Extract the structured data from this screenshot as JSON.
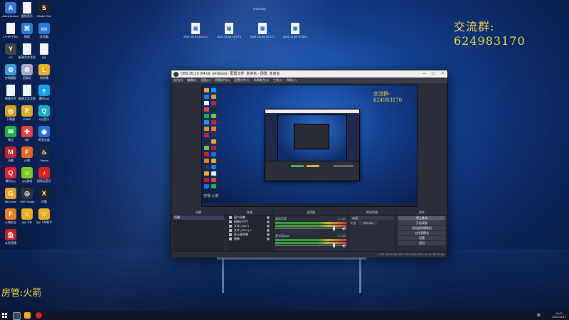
{
  "desktop": {
    "watermark_qq": "交流群: 624983170",
    "watermark_admin": "房管:火箭",
    "icons": [
      {
        "label": "Administrator",
        "color": "#3a78d8",
        "glyph": "A"
      },
      {
        "label": "酷狗音乐",
        "color": "#f4f6fa",
        "glyph": ""
      },
      {
        "label": "Studio One",
        "color": "#222",
        "glyph": "S"
      },
      {
        "label": "4THRTFMC",
        "color": "#f4f6fa",
        "glyph": ""
      },
      {
        "label": "网络",
        "color": "#2a7bd8",
        "glyph": "⌘"
      },
      {
        "label": "此电脑",
        "color": "#2a7bd8",
        "glyph": "▭"
      },
      {
        "label": "YY",
        "color": "#444",
        "glyph": "Y"
      },
      {
        "label": "新建文本文档",
        "color": "#f4f6fa",
        "glyph": ""
      },
      {
        "label": "QQ",
        "color": "#f4f6fa",
        "glyph": ""
      },
      {
        "label": "控制面板",
        "color": "#3a9ad8",
        "glyph": "⚙"
      },
      {
        "label": "回收站",
        "color": "#aac",
        "glyph": "♻"
      },
      {
        "label": "快剪辑",
        "color": "#e8b020",
        "glyph": "L"
      },
      {
        "label": "新建文件",
        "color": "#f4f6fa",
        "glyph": ""
      },
      {
        "label": "新建文本文档",
        "color": "#f4f6fa",
        "glyph": ""
      },
      {
        "label": "腾讯QQ",
        "color": "#12a0e8",
        "glyph": "e"
      },
      {
        "label": "下载器",
        "color": "#d8a020",
        "glyph": "◎"
      },
      {
        "label": "PUBG",
        "color": "#d8b020",
        "glyph": "P"
      },
      {
        "label": "QQ音乐",
        "color": "#12b0c0",
        "glyph": "Q"
      },
      {
        "label": "微信",
        "color": "#25b04a",
        "glyph": "✉"
      },
      {
        "label": "360",
        "color": "#e84040",
        "glyph": "✚"
      },
      {
        "label": "阿里云盘",
        "color": "#2a6fd8",
        "glyph": "◉"
      },
      {
        "label": "迅雷",
        "color": "#c82030",
        "glyph": "M"
      },
      {
        "label": "火绒",
        "color": "#e86820",
        "glyph": "F"
      },
      {
        "label": "Steam",
        "color": "#1b2838",
        "glyph": "♨"
      },
      {
        "label": "腾讯QQ",
        "color": "#e82040",
        "glyph": "Q"
      },
      {
        "label": "QQ游戏",
        "color": "#80c820",
        "glyph": "☺"
      },
      {
        "label": "网易云音乐",
        "color": "#d82020",
        "glyph": "♪"
      },
      {
        "label": "WeGame",
        "color": "#e8a020",
        "glyph": "G"
      },
      {
        "label": "OBS Studio",
        "color": "#333",
        "glyph": "◎"
      },
      {
        "label": "优酷",
        "color": "#222",
        "glyph": "X"
      },
      {
        "label": "火绒安全",
        "color": "#e88020",
        "glyph": "F"
      },
      {
        "label": "QQ飞车",
        "color": "#e8b020",
        "glyph": "☺"
      },
      {
        "label": "QQ飞车助手",
        "color": "#e8b020",
        "glyph": "☺"
      },
      {
        "label": "斗鱼直播",
        "color": "#c82020",
        "glyph": "鱼"
      }
    ],
    "top_files": [
      {
        "label": "2021-09-03 18:15:48..."
      },
      {
        "label": "2021-11-08 21:27:44..."
      },
      {
        "label": "2021-09-16 22:27:48..."
      },
      {
        "label": "2021-11-03 10:51:41..."
      }
    ],
    "top_file_extra": "NTRHMC"
  },
  "obs": {
    "title": "OBS 26.1.0 (64-bit, windows) - 配置文件: 未命名 - 场景: 未命名",
    "menu": [
      "文件(F)",
      "编辑(E)",
      "视图(V)",
      "停靠部件(D)",
      "配置文件(P)",
      "场景集合(S)",
      "工具(T)",
      "帮助(H)"
    ],
    "preview_watermark": "交流群: 624983170",
    "preview_admin": "房管:火箭",
    "docks": {
      "scenes_title": "场景",
      "scenes": [
        "场景"
      ],
      "sources_title": "来源",
      "sources": [
        "窗口采集",
        "图像幻灯片",
        "文本 (GDI+)",
        "文本 (GDI+) 2",
        "显示器采集",
        "图像"
      ],
      "mixer_title": "混音器",
      "mixer": [
        {
          "label": "桌面音频",
          "db": "0.0 dB"
        },
        {
          "label": "麦克风/Aux",
          "db": "0.0 dB"
        }
      ],
      "transitions_title": "转场特效",
      "transition_value": "淡出",
      "duration_label": "时长",
      "duration_value": "300 ms",
      "controls_title": "控件",
      "controls": [
        "停止推流",
        "开始录制",
        "启动虚拟摄像机",
        "工作室模式",
        "设置",
        "退出"
      ]
    },
    "status": "LIVE: 00:30:55   REC: 00:00:00   CPU: 9.1%, 60.00 fps"
  },
  "taskbar": {
    "time": "19:21",
    "date": "2021/11/17",
    "lang": "英"
  }
}
